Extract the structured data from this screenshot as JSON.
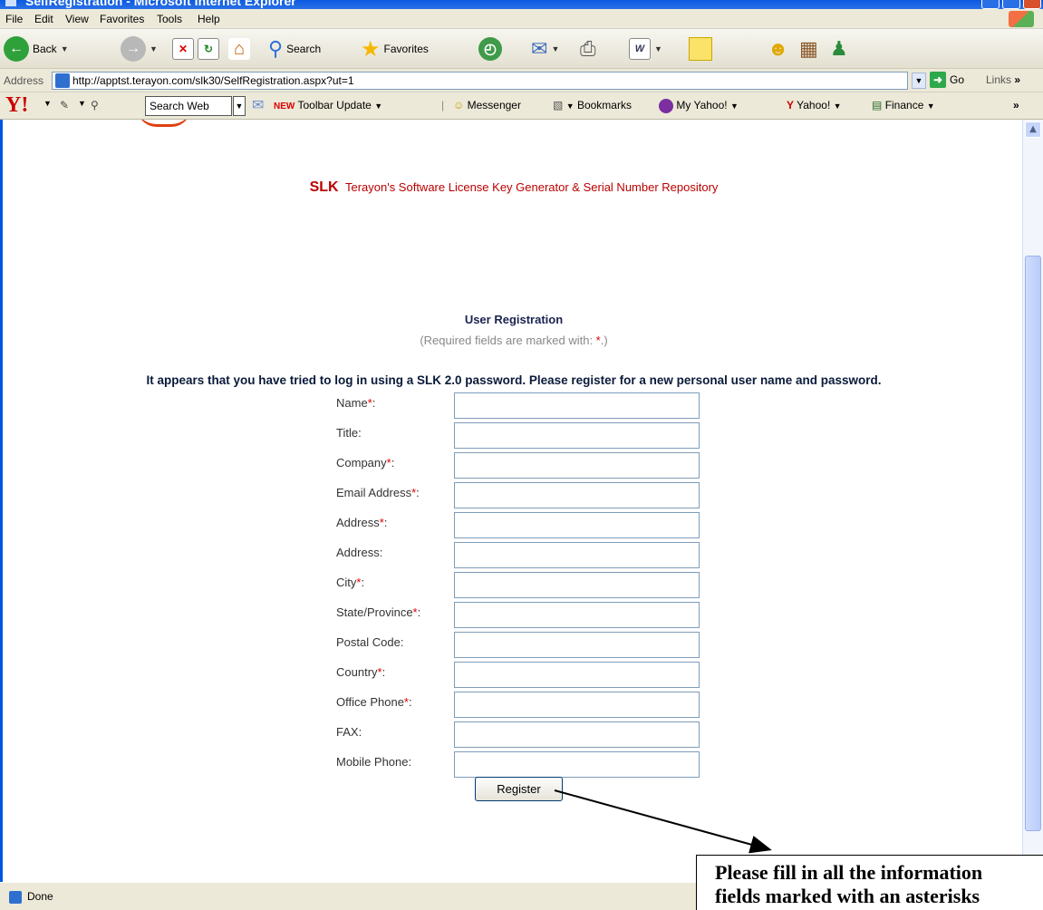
{
  "window": {
    "title": "SelfRegistration - Microsoft Internet Explorer"
  },
  "menu": [
    "File",
    "Edit",
    "View",
    "Favorites",
    "Tools",
    "Help"
  ],
  "toolbar": {
    "back_label": "Back",
    "search_label": "Search",
    "favorites_label": "Favorites"
  },
  "address": {
    "label": "Address",
    "url": "http://apptst.terayon.com/slk30/SelfRegistration.aspx?ut=1",
    "go_label": "Go",
    "links_label": "Links",
    "links_chevron": "»"
  },
  "yahoo_toolbar": {
    "logo": "Y!",
    "search_box": "Search Web",
    "toolbar_update": "Toolbar Update",
    "messenger": "Messenger",
    "bookmarks": "Bookmarks",
    "my_yahoo": "My Yahoo!",
    "yahoo": "Yahoo!",
    "finance": "Finance",
    "overflow": "»"
  },
  "page": {
    "slk_brand": "SLK",
    "slk_tagline": "Terayon's Software License Key Generator & Serial Number Repository",
    "registration_title": "User Registration",
    "required_note_prefix": "(Required fields are marked with: ",
    "required_note_star": "*",
    "required_note_suffix": ".)",
    "notice": "It appears that you have tried to log in using a SLK 2.0 password. Please register for a new personal user name and password.",
    "fields": [
      {
        "label": "Name",
        "required": true
      },
      {
        "label": "Title",
        "required": false
      },
      {
        "label": "Company",
        "required": true
      },
      {
        "label": "Email Address",
        "required": true
      },
      {
        "label": "Address",
        "required": true
      },
      {
        "label": "Address",
        "required": false
      },
      {
        "label": "City",
        "required": true
      },
      {
        "label": "State/Province",
        "required": true
      },
      {
        "label": "Postal Code",
        "required": false
      },
      {
        "label": "Country",
        "required": true
      },
      {
        "label": "Office Phone",
        "required": true
      },
      {
        "label": "FAX",
        "required": false
      },
      {
        "label": "Mobile Phone",
        "required": false
      }
    ],
    "register_button": "Register"
  },
  "status": {
    "text": "Done"
  },
  "annotation": {
    "line1": "Please fill in all the information",
    "line2": "fields marked with an asterisks"
  },
  "colors": {
    "brand_red": "#b00000",
    "heading_navy": "#1a2350",
    "required_star": "#dd0000"
  }
}
